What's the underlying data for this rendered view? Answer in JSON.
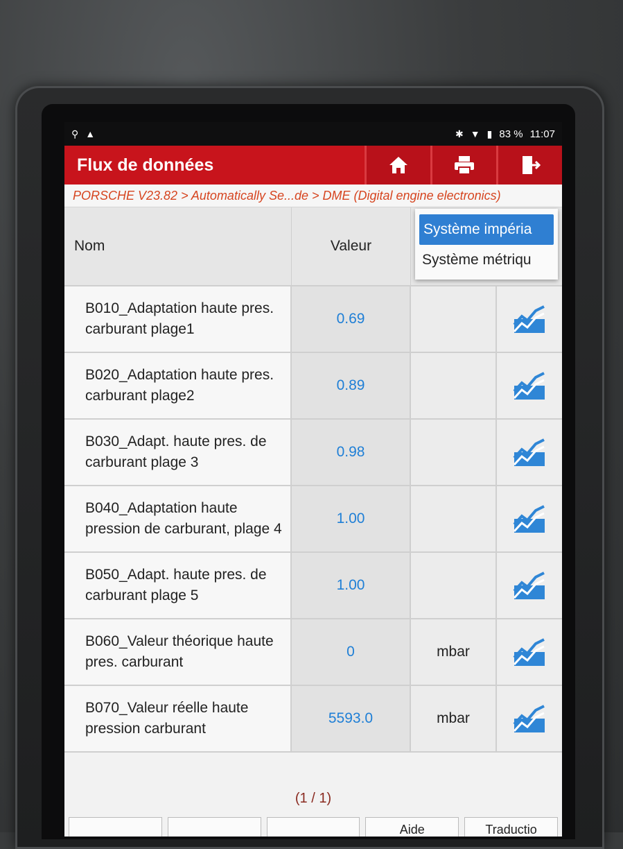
{
  "status_bar": {
    "battery": "83 %",
    "time": "11:07"
  },
  "header": {
    "title": "Flux de données"
  },
  "breadcrumb": "PORSCHE V23.82 > Automatically Se...de > DME (Digital engine electronics)",
  "table": {
    "col_name": "Nom",
    "col_value": "Valeur",
    "rows": [
      {
        "name": "B010_Adaptation haute pres. carburant plage1",
        "value": "0.69",
        "unit": ""
      },
      {
        "name": "B020_Adaptation haute pres. carburant plage2",
        "value": "0.89",
        "unit": ""
      },
      {
        "name": "B030_Adapt. haute pres. de carburant plage 3",
        "value": "0.98",
        "unit": ""
      },
      {
        "name": "B040_Adaptation haute pression de carburant, plage 4",
        "value": "1.00",
        "unit": ""
      },
      {
        "name": "B050_Adapt. haute pres. de carburant plage 5",
        "value": "1.00",
        "unit": ""
      },
      {
        "name": "B060_Valeur théorique haute pres. carburant",
        "value": "0",
        "unit": "mbar"
      },
      {
        "name": "B070_Valeur réelle haute pression carburant",
        "value": "5593.0",
        "unit": "mbar"
      }
    ]
  },
  "unit_menu": {
    "options": [
      "Système impéria",
      "Système métriqu"
    ],
    "selected_index": 0
  },
  "footer": {
    "page": "(1 / 1)",
    "buttons": [
      "",
      "",
      "",
      "Aide",
      "Traductio"
    ]
  }
}
